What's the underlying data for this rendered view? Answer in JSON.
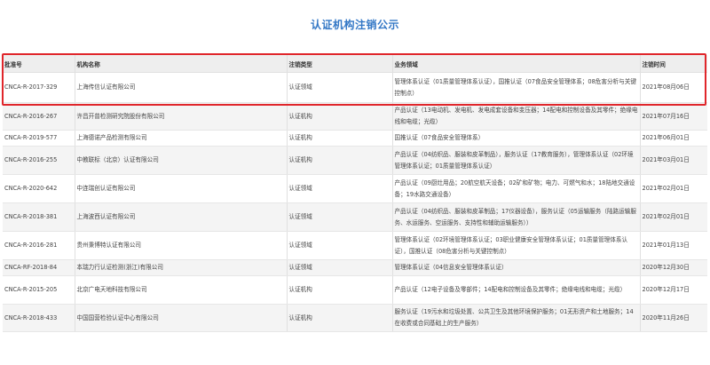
{
  "page": {
    "title": "认证机构注销公示"
  },
  "table": {
    "headers": {
      "no": "批准号",
      "org": "机构名称",
      "type": "注销类型",
      "field": "业务领域",
      "date": "注销时间"
    },
    "rows": [
      {
        "no": "CNCA-R-2017-329",
        "org": "上海传信认证有限公司",
        "type": "认证领域",
        "field": "管理体系认证（01质量管理体系认证），国推认证（07食品安全管理体系；08危害分析与关键控制点）",
        "date": "2021年08月06日"
      },
      {
        "no": "CNCA-R-2016-267",
        "org": "许昌开普检测研究院股份有限公司",
        "type": "认证机构",
        "field": "产品认证（13电动机、发电机、发电成套设备和变压器；14配电和控制设备及其零件；绝缘电线和电缆；光缆）",
        "date": "2021年07月16日"
      },
      {
        "no": "CNCA-R-2019-577",
        "org": "上海德诺产品检测有限公司",
        "type": "认证机构",
        "field": "国推认证（07食品安全管理体系）",
        "date": "2021年06月01日"
      },
      {
        "no": "CNCA-R-2016-255",
        "org": "中教联标（北京）认证有限公司",
        "type": "认证机构",
        "field": "产品认证（04纺织品、服装和皮革制品），服务认证（17教育服务），管理体系认证（02环境管理体系认证；01质量管理体系认证）",
        "date": "2021年03月01日"
      },
      {
        "no": "CNCA-R-2020-642",
        "org": "中连瑞创认证有限公司",
        "type": "认证领域",
        "field": "产品认证（09厨灶用品；20航空航天设备；02矿和矿物；电力、可燃气和水；18陆地交通设备；19水路交通设备）",
        "date": "2021年02月01日"
      },
      {
        "no": "CNCA-R-2018-381",
        "org": "上海波西认证有限公司",
        "type": "认证领域",
        "field": "产品认证（04纺织品、服装和皮革制品；17仪器设备），服务认证（05运输服务（陆路运输服务、水运服务、空运服务、支持性和辅助运输服务））",
        "date": "2021年02月01日"
      },
      {
        "no": "CNCA-R-2016-281",
        "org": "贵州秉博特认证有限公司",
        "type": "认证领域",
        "field": "管理体系认证（02环境管理体系认证；03职业健康安全管理体系认证；01质量管理体系认证），国推认证（08危害分析与关键控制点）",
        "date": "2021年01月13日"
      },
      {
        "no": "CNCA-RF-2018-84",
        "org": "本瑞力行认证检测(浙江)有限公司",
        "type": "认证领域",
        "field": "管理体系认证（04信息安全管理体系认证）",
        "date": "2020年12月30日"
      },
      {
        "no": "CNCA-R-2015-205",
        "org": "北京广电天地科技有限公司",
        "type": "认证机构",
        "field": "产品认证（12电子设备及零部件；14配电和控制设备及其零件；绝缘电线和电缆；光缆）",
        "date": "2020年12月17日"
      },
      {
        "no": "CNCA-R-2018-433",
        "org": "中国国营检验认证中心有限公司",
        "type": "认证机构",
        "field": "服务认证（19污水和垃圾处置、公共卫生及其他环境保护服务；01无形资产和土地服务；14在收费或合同基础上的生产服务）",
        "date": "2020年11月26日"
      }
    ]
  },
  "colors": {
    "title": "#3478c6",
    "highlight_border": "#e0262b",
    "header_bg": "#eeeeee",
    "alt_row_bg": "#f4f4f4"
  }
}
